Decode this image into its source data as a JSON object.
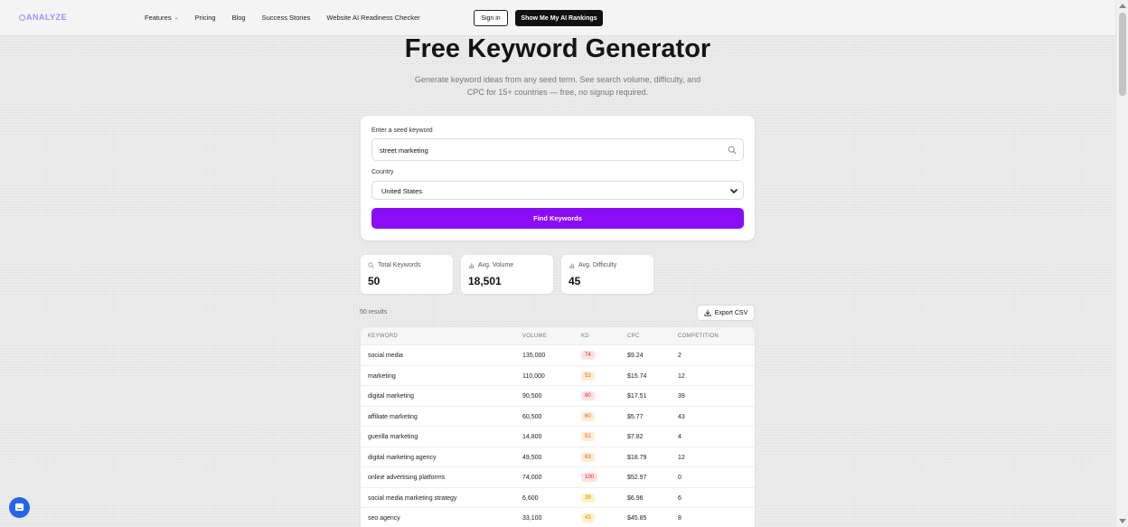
{
  "brand": {
    "logo_text": "ANALYZE"
  },
  "nav": {
    "links": [
      "Features",
      "Pricing",
      "Blog",
      "Success Stories",
      "Website AI Readiness Checker"
    ],
    "signin_label": "Sign in",
    "cta_label": "Show Me My AI Rankings"
  },
  "hero": {
    "title": "Free Keyword Generator",
    "subtitle": "Generate keyword ideas from any seed term. See search volume, difficulty, and CPC for 15+ countries — free, no signup required."
  },
  "form": {
    "seed_label": "Enter a seed keyword",
    "seed_value": "street marketing",
    "country_label": "Country",
    "country_value": "United States",
    "submit_label": "Find Keywords"
  },
  "stats": [
    {
      "label": "Total Keywords",
      "value": "50",
      "icon": "search-icon"
    },
    {
      "label": "Avg. Volume",
      "value": "18,501",
      "icon": "bar-chart-icon"
    },
    {
      "label": "Avg. Difficulty",
      "value": "45",
      "icon": "bar-chart-icon"
    }
  ],
  "results": {
    "count_text": "50 results",
    "export_label": "Export CSV"
  },
  "table": {
    "headers": [
      "KEYWORD",
      "VOLUME",
      "KD",
      "CPC",
      "COMPETITION"
    ],
    "rows": [
      {
        "keyword": "social media",
        "volume": "135,000",
        "kd": "74",
        "cpc": "$9.24",
        "competition": "2"
      },
      {
        "keyword": "marketing",
        "volume": "110,000",
        "kd": "53",
        "cpc": "$15.74",
        "competition": "12"
      },
      {
        "keyword": "digital marketing",
        "volume": "90,500",
        "kd": "80",
        "cpc": "$17.51",
        "competition": "39"
      },
      {
        "keyword": "affiliate marketing",
        "volume": "60,500",
        "kd": "60",
        "cpc": "$5.77",
        "competition": "43"
      },
      {
        "keyword": "guerilla marketing",
        "volume": "14,800",
        "kd": "51",
        "cpc": "$7.82",
        "competition": "4"
      },
      {
        "keyword": "digital marketing agency",
        "volume": "49,500",
        "kd": "63",
        "cpc": "$18.79",
        "competition": "12"
      },
      {
        "keyword": "online advertising platforms",
        "volume": "74,000",
        "kd": "100",
        "cpc": "$52.97",
        "competition": "0"
      },
      {
        "keyword": "social media marketing strategy",
        "volume": "6,600",
        "kd": "39",
        "cpc": "$6.96",
        "competition": "6"
      },
      {
        "keyword": "seo agency",
        "volume": "33,100",
        "kd": "43",
        "cpc": "$45.85",
        "competition": "8"
      }
    ]
  },
  "colors": {
    "accent": "#8b0cf7",
    "kd_high_bg": "#fde2e2",
    "kd_high_fg": "#dc2626",
    "kd_mid_bg": "#ffedd5",
    "kd_mid_fg": "#ea580c",
    "kd_low_bg": "#fef3c7",
    "kd_low_fg": "#ca8a04"
  }
}
